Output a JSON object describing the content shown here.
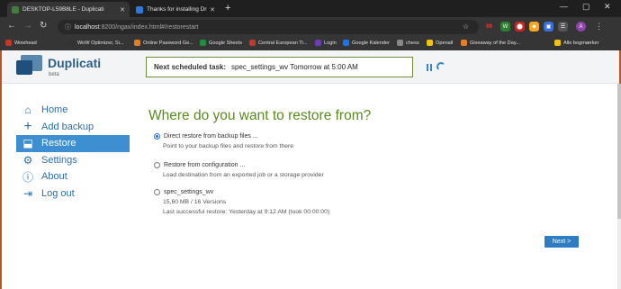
{
  "browser": {
    "tabs": [
      {
        "title": "DESKTOP-L59B8LE - Duplicati",
        "favicon_color": "#3f7d3f"
      },
      {
        "title": "Thanks for installing Driver Boo",
        "favicon_color": "#2b79d8"
      }
    ],
    "new_tab": "+",
    "window_controls": [
      "—",
      "▢",
      "✕"
    ],
    "url_host": "localhost",
    "url_path": ":8200/ngax/index.html#/restorestart",
    "extensions": [
      {
        "label": "99",
        "color": "#c0392b"
      },
      {
        "label": "W",
        "color": "#2e7d32"
      },
      {
        "label": "⬤",
        "color": "#c62828"
      },
      {
        "label": "◆",
        "color": "#f5a623"
      },
      {
        "label": "▣",
        "color": "#3a6fd8"
      },
      {
        "label": "✚",
        "color": "#8e44ad"
      },
      {
        "label": "☰",
        "color": "#555"
      },
      {
        "label": "A",
        "color": "#8e44ad"
      }
    ],
    "bookmarks": [
      {
        "label": "Wowhead",
        "color": "#c0392b"
      },
      {
        "label": "WoW Optimizer, Si...",
        "color": "#333"
      },
      {
        "label": "Online Password Ge...",
        "color": "#e67e22"
      },
      {
        "label": "Google Sheets",
        "color": "#1e8e3e"
      },
      {
        "label": "Central European Ti...",
        "color": "#c0392b"
      },
      {
        "label": "Login",
        "color": "#6a3fb5"
      },
      {
        "label": "Google Kalender",
        "color": "#1a73e8"
      },
      {
        "label": "chess",
        "color": "#888"
      },
      {
        "label": "Openall",
        "color": "#f1c40f"
      },
      {
        "label": "Giveaway of the Day...",
        "color": "#e67e22"
      }
    ],
    "all_bookmarks": "Alle bogmærker"
  },
  "header": {
    "brand": "Duplicati",
    "brand_sub": "beta",
    "next_task_label": "Next scheduled task:",
    "next_task_value": "spec_settings_wv Tomorrow at 5:00 AM"
  },
  "sidebar": {
    "items": [
      {
        "label": "Home",
        "icon": "home-icon",
        "glyph": "⌂"
      },
      {
        "label": "Add backup",
        "icon": "plus-icon",
        "glyph": "+"
      },
      {
        "label": "Restore",
        "icon": "restore-icon",
        "glyph": "⬓"
      },
      {
        "label": "Settings",
        "icon": "gear-icon",
        "glyph": "⚙"
      },
      {
        "label": "About",
        "icon": "info-icon",
        "glyph": "ⓘ"
      },
      {
        "label": "Log out",
        "icon": "logout-icon",
        "glyph": "⇥"
      }
    ],
    "active_index": 2
  },
  "main": {
    "heading": "Where do you want to restore from?",
    "options": [
      {
        "title": "Direct restore from backup files ...",
        "desc": "Point to your backup files and restore from there",
        "checked": true
      },
      {
        "title": "Restore from configuration ...",
        "desc": "Load destination from an exported job or a storage provider",
        "checked": false
      },
      {
        "title": "spec_settings_wv",
        "desc": "15,60 MB / 16 Versions",
        "desc2": "Last successful restore: Yesterday at 9:12 AM (took 00:00:00)",
        "checked": false
      }
    ],
    "next_button": "Next >"
  }
}
